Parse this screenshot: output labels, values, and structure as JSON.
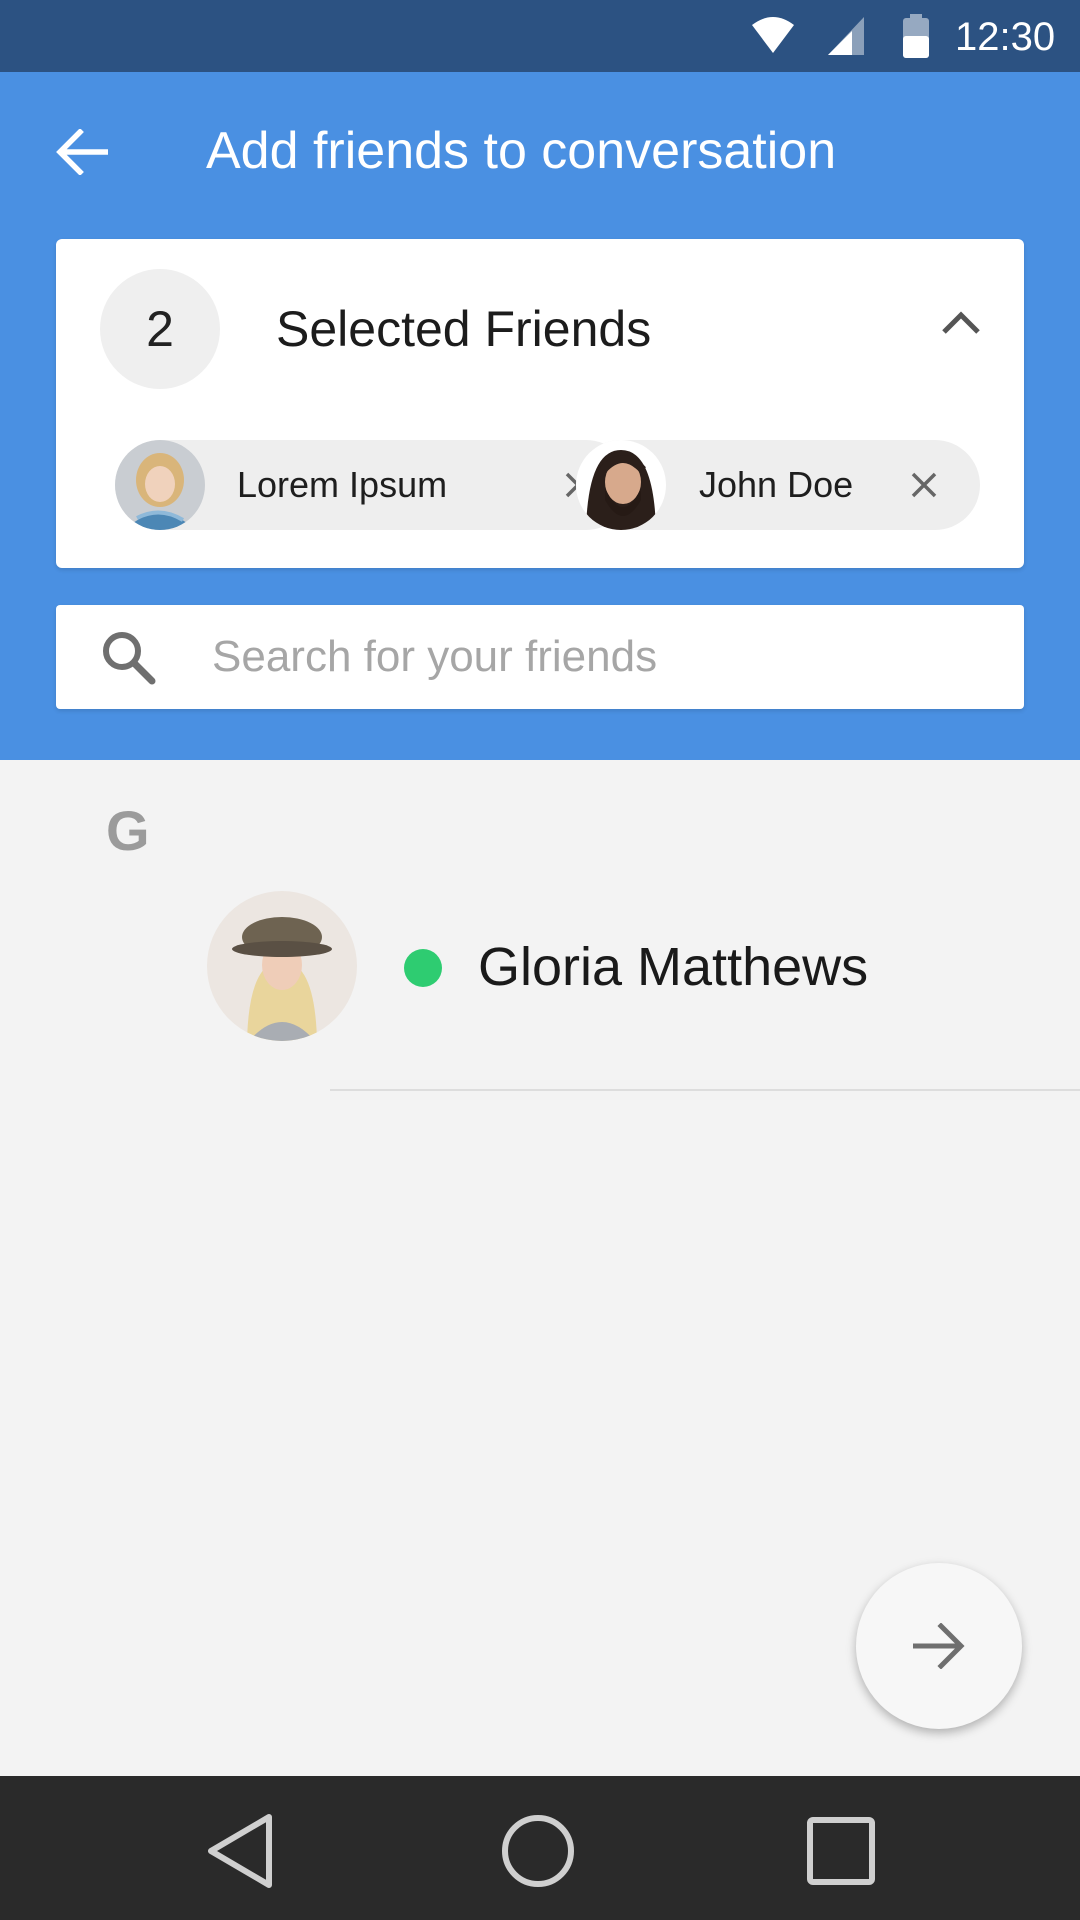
{
  "status_bar": {
    "time": "12:30",
    "icons": [
      "wifi-icon",
      "cellular-signal-icon",
      "battery-icon"
    ]
  },
  "app_bar": {
    "title": "Add friends to conversation",
    "back_icon": "arrow-left-icon",
    "background_color": "#4a90e2"
  },
  "selected": {
    "count": "2",
    "title": "Selected Friends",
    "collapse_icon": "chevron-up-icon",
    "chips": [
      {
        "name": "Lorem Ipsum",
        "remove_icon": "close-icon"
      },
      {
        "name": "John Doe",
        "remove_icon": "close-icon"
      }
    ]
  },
  "search": {
    "placeholder": "Search for your friends",
    "value": ""
  },
  "list": {
    "sections": [
      {
        "letter": "G",
        "items": [
          {
            "name": "Gloria Matthews",
            "status": "online",
            "status_color": "#2ecc71"
          }
        ]
      }
    ]
  },
  "fab": {
    "icon": "arrow-right-icon"
  },
  "nav_bar": {
    "buttons": [
      "back-triangle-icon",
      "home-circle-icon",
      "recents-square-icon"
    ]
  }
}
